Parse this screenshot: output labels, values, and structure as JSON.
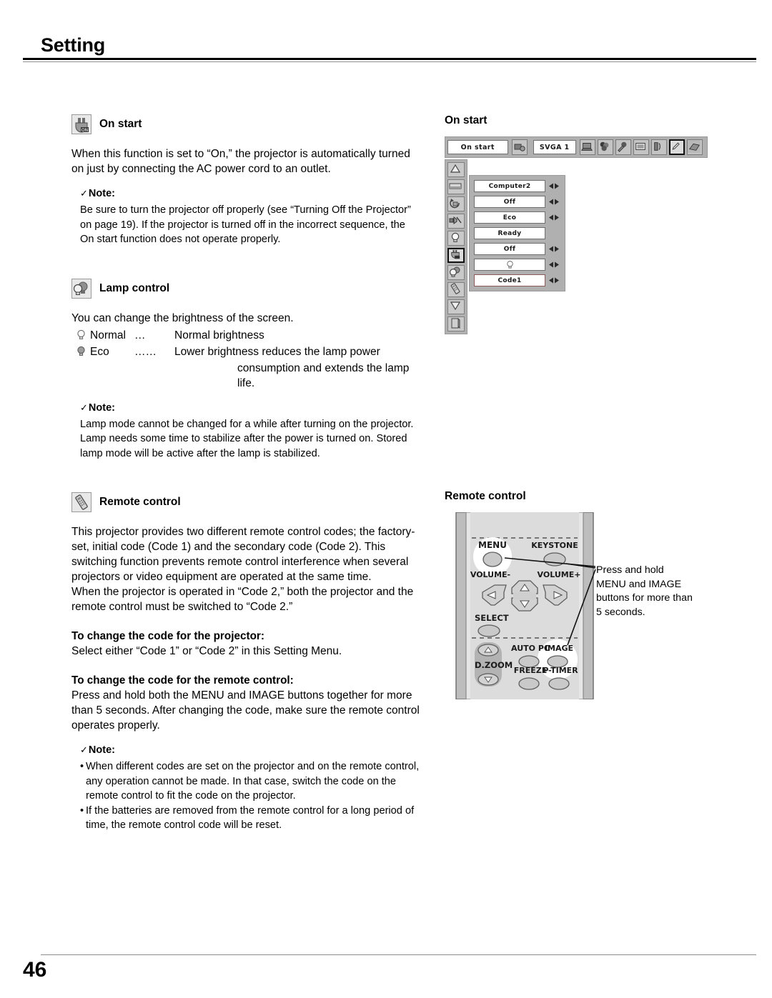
{
  "page": {
    "section_title": "Setting",
    "page_number": "46"
  },
  "left_column": {
    "on_start": {
      "icon": "on-start-plug-icon",
      "heading": "On start",
      "body": "When this function is set to “On,” the projector is automatically turned on just by connecting the AC power cord to an outlet.",
      "note_label": "Note:",
      "note_check": "✓",
      "note_body": "Be sure to turn the projector off properly (see “Turning Off the Projector” on page 19). If the projector is turned off in the incorrect sequence, the On start function does not operate properly."
    },
    "lamp_control": {
      "icon": "lamp-control-icon",
      "heading": "Lamp control",
      "body": "You can change the brightness of the screen.",
      "modes": [
        {
          "icon": "bulb-bright-icon",
          "name": "Normal",
          "dots": "…",
          "desc": "Normal brightness"
        },
        {
          "icon": "bulb-eco-icon",
          "name": "Eco",
          "dots": "……",
          "desc": "Lower brightness reduces the lamp power"
        }
      ],
      "mode_continuation": "consumption and extends the lamp life.",
      "note_label": "Note:",
      "note_check": "✓",
      "note_body": "Lamp mode cannot be changed for a while after turning on the projector. Lamp needs some time to stabilize after the power is turned on. Stored lamp mode will be active after the lamp is stabilized."
    },
    "remote_control": {
      "icon": "remote-control-icon",
      "heading": "Remote control",
      "body": "This projector provides two different remote control codes; the factory-set, initial code (Code 1) and the secondary code (Code 2). This switching function prevents remote control interference when several projectors or video equipment are operated at the same time.\nWhen the projector is operated in “Code 2,” both the projector and the remote control must be switched to “Code 2.”",
      "projector_sub": "To change the code for the projector:",
      "projector_body": "Select either “Code 1” or “Code 2” in this Setting Menu.",
      "remote_sub": "To change the code for the remote control:",
      "remote_body": "Press and hold both the MENU and IMAGE buttons together for more than 5 seconds. After changing the code, make sure the remote control operates properly.",
      "note_label": "Note:",
      "note_check": "✓",
      "bullets": [
        "When different codes are set on the projector and on the remote control, any operation cannot be made. In that case, switch the code on the remote control to fit the code on the projector.",
        "If the batteries are removed from the remote control for a long period of time, the remote control code will be reset."
      ],
      "bullet_marker": "•"
    }
  },
  "right_column": {
    "osd": {
      "heading": "On start",
      "topbar": {
        "menu_title": "On start",
        "source_icon": "input-source-icon",
        "resolution": "SVGA 1",
        "category_icons": [
          "computer-input-icon",
          "color-adjust-icon",
          "image-adjust-icon",
          "screen-size-icon",
          "sound-icon",
          "setting-pencil-icon",
          "information-icon"
        ],
        "selected_category_index": 5
      },
      "sidebar_icons": [
        "scroll-up-icon",
        "screen-icon",
        "ceiling-rear-icon",
        "sound-mute-icon",
        "lamp-icon",
        "on-start-icon",
        "lamp-control-icon",
        "remote-control-icon",
        "scroll-down-icon",
        "quit-icon"
      ],
      "sidebar_selected_index": 5,
      "rows": [
        {
          "value": "Computer2",
          "arrows": true,
          "highlight": false
        },
        {
          "value": "Off",
          "arrows": true,
          "highlight": false
        },
        {
          "value": "Eco",
          "arrows": true,
          "highlight": false
        },
        {
          "value": "Ready",
          "arrows": false,
          "highlight": false
        },
        {
          "value": "Off",
          "arrows": true,
          "highlight": false
        },
        {
          "value": "",
          "arrows": true,
          "highlight": false,
          "icon": "bulb-icon"
        },
        {
          "value": "Code1",
          "arrows": true,
          "highlight": true
        }
      ]
    },
    "remote": {
      "heading": "Remote control",
      "callout": "Press and hold MENU and IMAGE buttons for more than 5 seconds.",
      "buttons": {
        "menu": "MENU",
        "keystone": "KEYSTONE",
        "volume_minus": "VOLUME-",
        "volume_plus": "VOLUME+",
        "select": "SELECT",
        "dzoom": "D.ZOOM",
        "auto_pc": "AUTO PC",
        "image": "IMAGE",
        "freeze": "FREEZE",
        "p_timer": "P-TIMER"
      },
      "highlighted_buttons": [
        "menu",
        "image"
      ]
    }
  },
  "colors": {
    "osd_gray": "#b0b0b0",
    "osd_field_white": "#ffffff",
    "rule_gray": "#8d8d8d",
    "text_black": "#000000",
    "remote_body": "#d9d9d9",
    "remote_button": "#c0c0c0"
  }
}
